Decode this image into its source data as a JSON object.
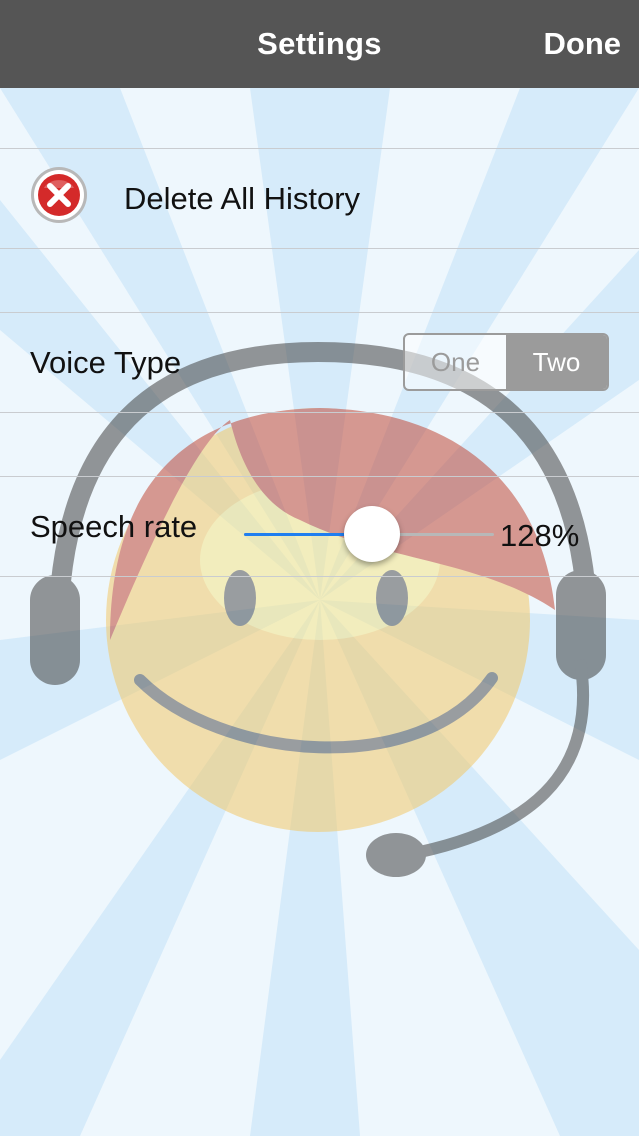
{
  "navbar": {
    "title": "Settings",
    "done_label": "Done"
  },
  "rows": {
    "delete_history_label": "Delete All History",
    "voice_type_label": "Voice Type",
    "speech_rate_label": "Speech rate"
  },
  "voice_type": {
    "options": [
      "One",
      "Two"
    ],
    "selected": "Two"
  },
  "speech_rate": {
    "value_text": "128%",
    "slider_fraction": 0.51
  },
  "colors": {
    "navbar": "#555555",
    "accent": "#1f7ef0",
    "delete_icon": "#d42a2a",
    "segment_selected": "#9b9b9b",
    "background_rays": "#d8ecfa"
  },
  "icons": {
    "delete": "delete-x-icon",
    "background": "headset-smiley-illustration"
  }
}
